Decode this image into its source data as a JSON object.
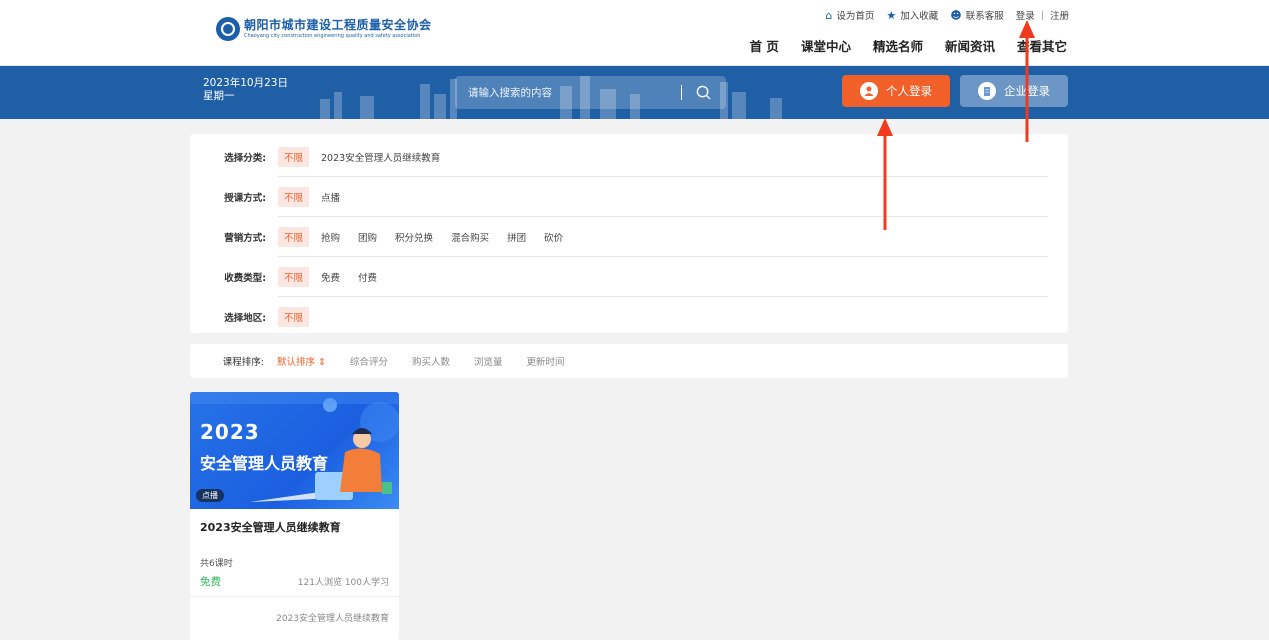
{
  "header": {
    "logo_title": "朝阳市城市建设工程质量安全协会",
    "logo_subtitle": "Chaoyang city construction engineering quality and safety association",
    "quicklinks": [
      {
        "label": "设为首页",
        "icon": "home-icon"
      },
      {
        "label": "加入收藏",
        "icon": "star-icon"
      },
      {
        "label": "联系客服",
        "icon": "service-icon"
      }
    ],
    "login_label": "登录",
    "register_label": "注册",
    "nav": [
      "首 页",
      "课堂中心",
      "精选名师",
      "新闻资讯",
      "查看其它"
    ]
  },
  "banner": {
    "date": "2023年10月23日",
    "weekday": "星期一",
    "search_placeholder": "请输入搜索的内容",
    "personal_login": "个人登录",
    "enterprise_login": "企业登录"
  },
  "filters": [
    {
      "label": "选择分类:",
      "options": [
        "不限",
        "2023安全管理人员继续教育"
      ]
    },
    {
      "label": "授课方式:",
      "options": [
        "不限",
        "点播"
      ]
    },
    {
      "label": "营销方式:",
      "options": [
        "不限",
        "抢购",
        "团购",
        "积分兑换",
        "混合购买",
        "拼团",
        "砍价"
      ]
    },
    {
      "label": "收费类型:",
      "options": [
        "不限",
        "免费",
        "付费"
      ]
    },
    {
      "label": "选择地区:",
      "options": [
        "不限"
      ]
    }
  ],
  "sort": {
    "label": "课程排序:",
    "options": [
      "默认排序 ⇕",
      "综合评分",
      "购买人数",
      "浏览量",
      "更新时间"
    ]
  },
  "course": {
    "image_year": "2023",
    "image_title": "安全管理人员教育",
    "badge": "点播",
    "title": "2023安全管理人员继续教育",
    "hours": "共6课时",
    "price": "免费",
    "stats": "121人浏览  100人学习",
    "category": "2023安全管理人员继续教育"
  },
  "colors": {
    "primary": "#1e5fa6",
    "accent": "#f2602a",
    "free": "#2fb35a"
  }
}
